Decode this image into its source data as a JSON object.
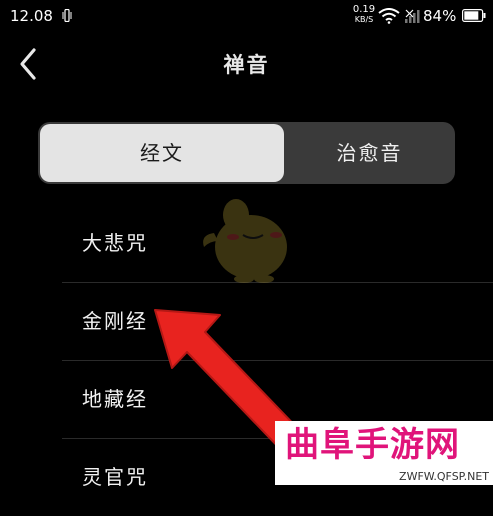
{
  "status_bar": {
    "time": "12.08",
    "net_speed_value": "0.19",
    "net_speed_unit": "KB/S",
    "battery": "84%",
    "icons": [
      "vibrate-icon",
      "wifi-icon",
      "signal-icon",
      "battery-icon"
    ]
  },
  "nav": {
    "back_icon": "chevron-left-icon",
    "title": "禅音"
  },
  "tabs": [
    {
      "label": "经文",
      "selected": true
    },
    {
      "label": "治愈音",
      "selected": false
    }
  ],
  "list": [
    {
      "label": "大悲咒"
    },
    {
      "label": "金刚经"
    },
    {
      "label": "地藏经"
    },
    {
      "label": "灵官咒"
    }
  ],
  "watermark": {
    "text": "曲阜手游网",
    "url": "ZWFW.QFSP.NET"
  },
  "colors": {
    "background": "#000000",
    "segment_bg": "#3a3a3a",
    "segment_active": "#e4e4e4",
    "arrow": "#e8231f",
    "watermark_text": "#e0147a"
  }
}
